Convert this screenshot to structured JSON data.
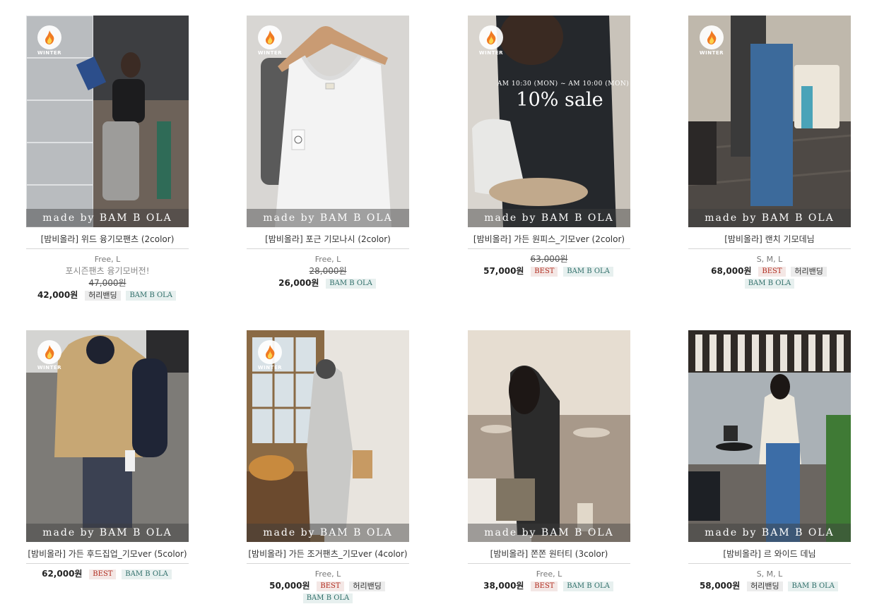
{
  "badge": {
    "label": "WINTER"
  },
  "watermark": "made by BAM B OLA",
  "sale_overlay": {
    "time": "AM 10:30 (MON) ~ AM 10:00 (MON)",
    "text": "10% sale"
  },
  "colors": {
    "best_text": "#b02a1d",
    "best_bg": "#f4e7e5",
    "brand_text": "#2f6e69",
    "brand_bg": "#e7f0ef",
    "rule": "#d6d6d6"
  },
  "products": [
    {
      "title": "[밤비올라] 위드 융기모팬츠 (2color)",
      "sizes": "Free, L",
      "desc": "포시즌팬츠 융기모버전!",
      "original_price": "47,000원",
      "price": "42,000원",
      "tags": [
        "허리밴딩",
        "BAM B OLA"
      ],
      "winter": true
    },
    {
      "title": "[밤비올라] 포근 기모나시 (2color)",
      "sizes": "Free, L",
      "desc": "",
      "original_price": "28,000원",
      "price": "26,000원",
      "tags": [
        "BAM B OLA"
      ],
      "winter": true
    },
    {
      "title": "[밤비올라] 가든 원피스_기모ver (2color)",
      "sizes": "",
      "desc": "",
      "original_price": "63,000원",
      "price": "57,000원",
      "tags": [
        "BEST",
        "BAM B OLA"
      ],
      "winter": true
    },
    {
      "title": "[밤비올라] 랜치 기모데님",
      "sizes": "S, M, L",
      "desc": "",
      "original_price": "",
      "price": "68,000원",
      "tags": [
        "BEST",
        "허리밴딩",
        "BAM B OLA"
      ],
      "winter": true
    },
    {
      "title": "[밤비올라] 가든 후드집업_기모ver (5color)",
      "sizes": "",
      "desc": "",
      "original_price": "",
      "price": "62,000원",
      "tags": [
        "BEST",
        "BAM B OLA"
      ],
      "winter": true
    },
    {
      "title": "[밤비올라] 가든 조거팬츠_기모ver (4color)",
      "sizes": "Free, L",
      "desc": "",
      "original_price": "",
      "price": "50,000원",
      "tags": [
        "BEST",
        "허리밴딩",
        "BAM B OLA"
      ],
      "winter": true
    },
    {
      "title": "[밤비올라] 쫀쫀 원터티 (3color)",
      "sizes": "Free, L",
      "desc": "",
      "original_price": "",
      "price": "38,000원",
      "tags": [
        "BEST",
        "BAM B OLA"
      ],
      "winter": false
    },
    {
      "title": "[밤비올라] 르 와이드 데님",
      "sizes": "S, M, L",
      "desc": "",
      "original_price": "",
      "price": "58,000원",
      "tags": [
        "허리밴딩",
        "BAM B OLA"
      ],
      "winter": false
    }
  ]
}
